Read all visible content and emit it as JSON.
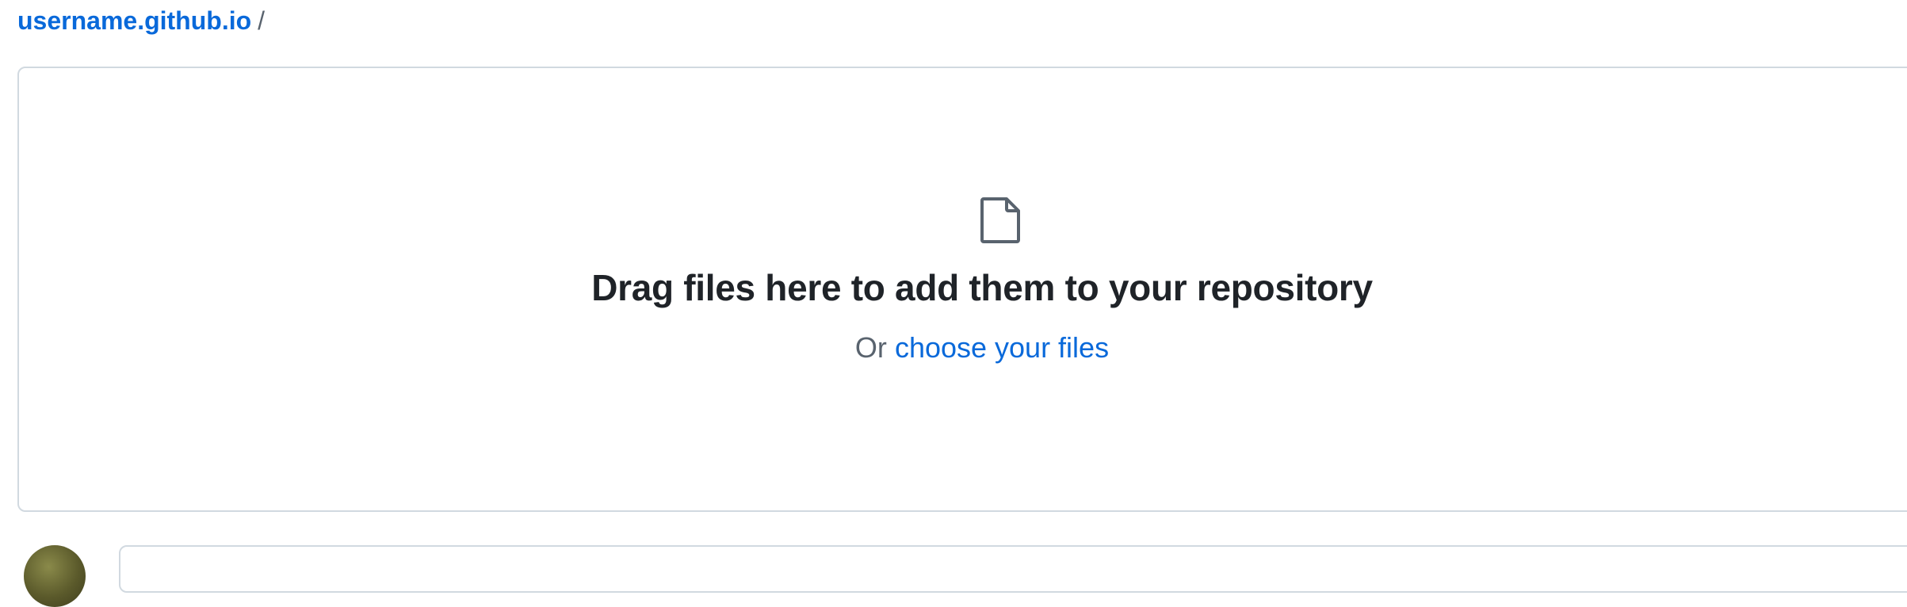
{
  "breadcrumb": {
    "repo": "username.github.io",
    "separator": "/"
  },
  "dropzone": {
    "icon": "file-icon",
    "title": "Drag files here to add them to your repository",
    "subtitle_prefix": "Or",
    "choose_link": "choose your files"
  },
  "colors": {
    "link": "#0969da",
    "text": "#1f2328",
    "muted": "#59636e",
    "border": "#d1d9e0"
  }
}
